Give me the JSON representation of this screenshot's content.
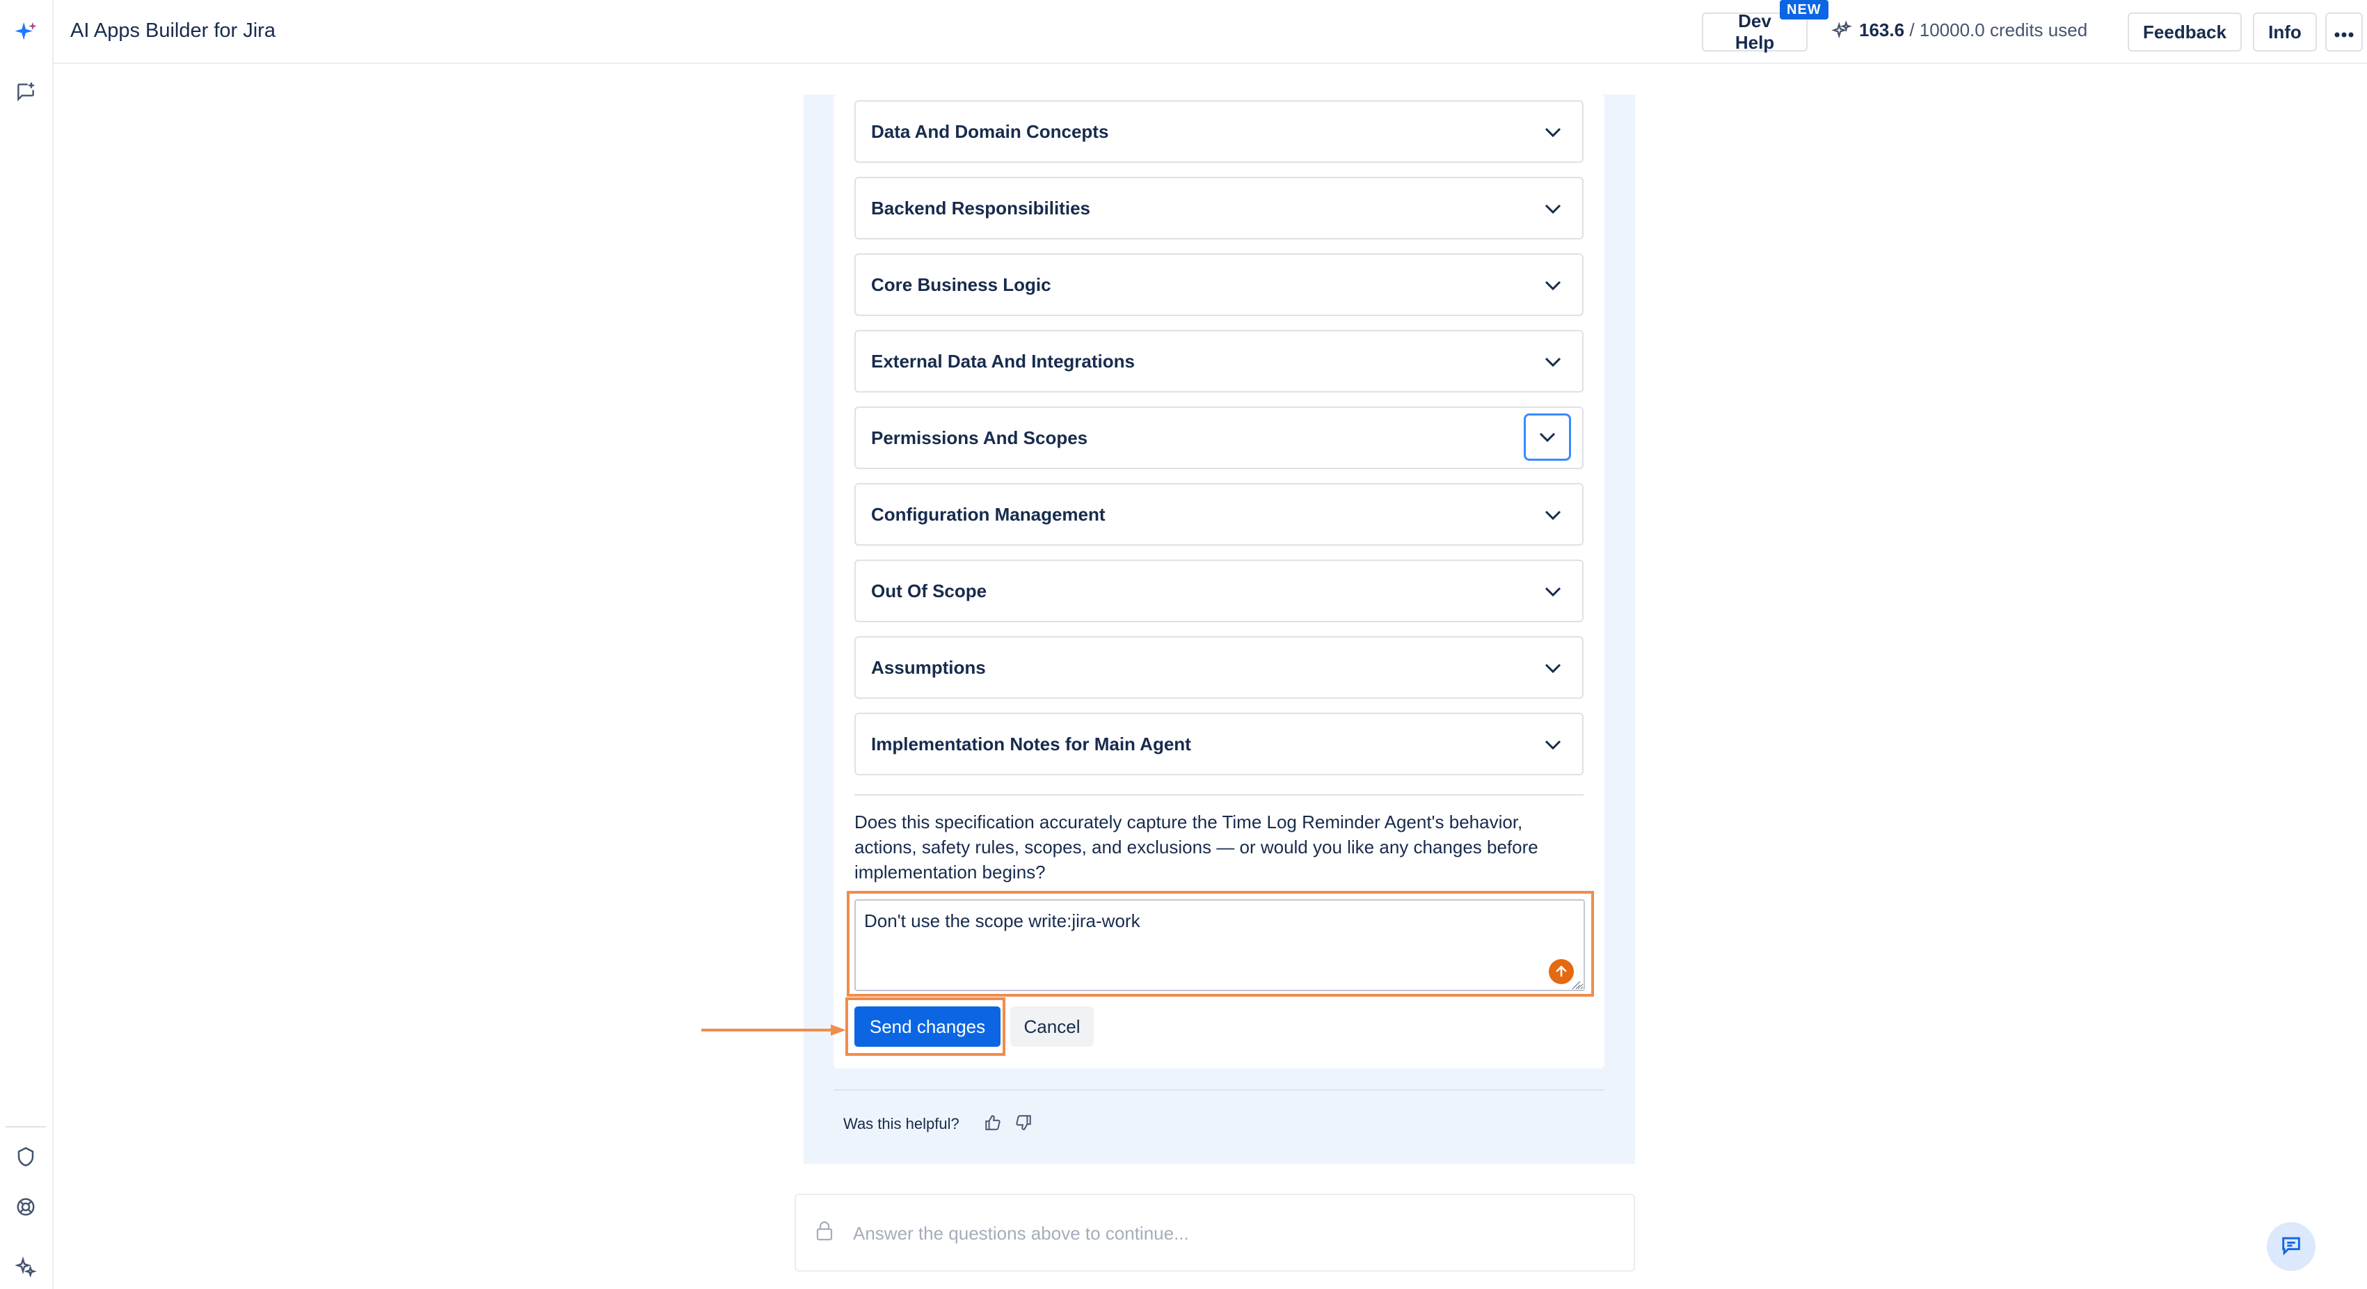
{
  "header": {
    "app_title": "AI Apps Builder for Jira",
    "dev_help_label": "Dev Help",
    "new_badge": "NEW",
    "credits_used_value": "163.6",
    "credits_suffix": "/ 10000.0 credits used",
    "feedback_label": "Feedback",
    "info_label": "Info",
    "more_icon": "more-horizontal-icon"
  },
  "sidebar": {
    "top_icons": [
      "ai-sparkle-icon",
      "new-chat-icon"
    ],
    "bottom_icons": [
      "shield-icon",
      "help-lifebuoy-icon",
      "sparkle-settings-icon"
    ]
  },
  "spec": {
    "sections": [
      {
        "label": "Data And Domain Concepts",
        "expanded": false
      },
      {
        "label": "Backend Responsibilities",
        "expanded": false
      },
      {
        "label": "Core Business Logic",
        "expanded": false
      },
      {
        "label": "External Data And Integrations",
        "expanded": false
      },
      {
        "label": "Permissions And Scopes",
        "expanded": false,
        "focused": true
      },
      {
        "label": "Configuration Management",
        "expanded": false
      },
      {
        "label": "Out Of Scope",
        "expanded": false
      },
      {
        "label": "Assumptions",
        "expanded": false
      },
      {
        "label": "Implementation Notes for Main Agent",
        "expanded": false
      }
    ],
    "question": "Does this specification accurately capture the Time Log Reminder Agent's behavior, actions, safety rules, scopes, and exclusions — or would you like any changes before implementation begins?",
    "feedback_value": "Don't use the scope write:jira-work",
    "send_label": "Send changes",
    "cancel_label": "Cancel"
  },
  "helpful": {
    "label": "Was this helpful?"
  },
  "composer": {
    "placeholder": "Answer the questions above to continue..."
  },
  "colors": {
    "primary": "#0c66e4",
    "highlight": "#f08c4c",
    "panel_bg": "#eef4fc"
  }
}
